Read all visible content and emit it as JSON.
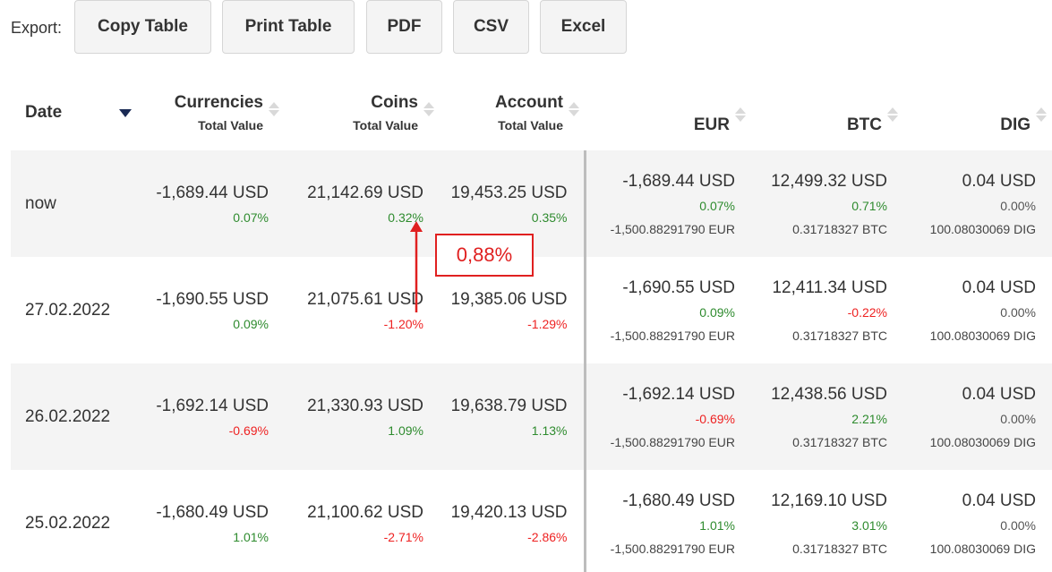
{
  "toolbar": {
    "label": "Export:",
    "buttons": [
      "Copy Table",
      "Print Table",
      "PDF",
      "CSV",
      "Excel"
    ]
  },
  "table": {
    "headers": {
      "date": "Date",
      "currencies": {
        "main": "Currencies",
        "sub": "Total Value"
      },
      "coins": {
        "main": "Coins",
        "sub": "Total Value"
      },
      "account": {
        "main": "Account",
        "sub": "Total Value"
      },
      "eur": "EUR",
      "btc": "BTC",
      "dig": "DIG"
    },
    "rows": [
      {
        "date": "now",
        "currencies": {
          "usd": "-1,689.44 USD",
          "pct": "0.07%"
        },
        "coins": {
          "usd": "21,142.69 USD",
          "pct": "0.32%"
        },
        "account": {
          "usd": "19,453.25 USD",
          "pct": "0.35%"
        },
        "eur": {
          "usd": "-1,689.44 USD",
          "pct": "0.07%",
          "hold": "-1,500.88291790 EUR"
        },
        "btc": {
          "usd": "12,499.32 USD",
          "pct": "0.71%",
          "hold": "0.31718327 BTC"
        },
        "dig": {
          "usd": "0.04 USD",
          "pct": "0.00%",
          "hold": "100.08030069 DIG"
        }
      },
      {
        "date": "27.02.2022",
        "currencies": {
          "usd": "-1,690.55 USD",
          "pct": "0.09%"
        },
        "coins": {
          "usd": "21,075.61 USD",
          "pct": "-1.20%"
        },
        "account": {
          "usd": "19,385.06 USD",
          "pct": "-1.29%"
        },
        "eur": {
          "usd": "-1,690.55 USD",
          "pct": "0.09%",
          "hold": "-1,500.88291790 EUR"
        },
        "btc": {
          "usd": "12,411.34 USD",
          "pct": "-0.22%",
          "hold": "0.31718327 BTC"
        },
        "dig": {
          "usd": "0.04 USD",
          "pct": "0.00%",
          "hold": "100.08030069 DIG"
        }
      },
      {
        "date": "26.02.2022",
        "currencies": {
          "usd": "-1,692.14 USD",
          "pct": "-0.69%"
        },
        "coins": {
          "usd": "21,330.93 USD",
          "pct": "1.09%"
        },
        "account": {
          "usd": "19,638.79 USD",
          "pct": "1.13%"
        },
        "eur": {
          "usd": "-1,692.14 USD",
          "pct": "-0.69%",
          "hold": "-1,500.88291790 EUR"
        },
        "btc": {
          "usd": "12,438.56 USD",
          "pct": "2.21%",
          "hold": "0.31718327 BTC"
        },
        "dig": {
          "usd": "0.04 USD",
          "pct": "0.00%",
          "hold": "100.08030069 DIG"
        }
      },
      {
        "date": "25.02.2022",
        "currencies": {
          "usd": "-1,680.49 USD",
          "pct": "1.01%"
        },
        "coins": {
          "usd": "21,100.62 USD",
          "pct": "-2.71%"
        },
        "account": {
          "usd": "19,420.13 USD",
          "pct": "-2.86%"
        },
        "eur": {
          "usd": "-1,680.49 USD",
          "pct": "1.01%",
          "hold": "-1,500.88291790 EUR"
        },
        "btc": {
          "usd": "12,169.10 USD",
          "pct": "3.01%",
          "hold": "0.31718327 BTC"
        },
        "dig": {
          "usd": "0.04 USD",
          "pct": "0.00%",
          "hold": "100.08030069 DIG"
        }
      }
    ]
  },
  "annotation": {
    "text": "0,88%",
    "color": "#e02020"
  },
  "colors": {
    "positive": "#2e8b2e",
    "negative": "#ee2222",
    "neutral": "#555555",
    "sort_active": "#1a2a55"
  }
}
